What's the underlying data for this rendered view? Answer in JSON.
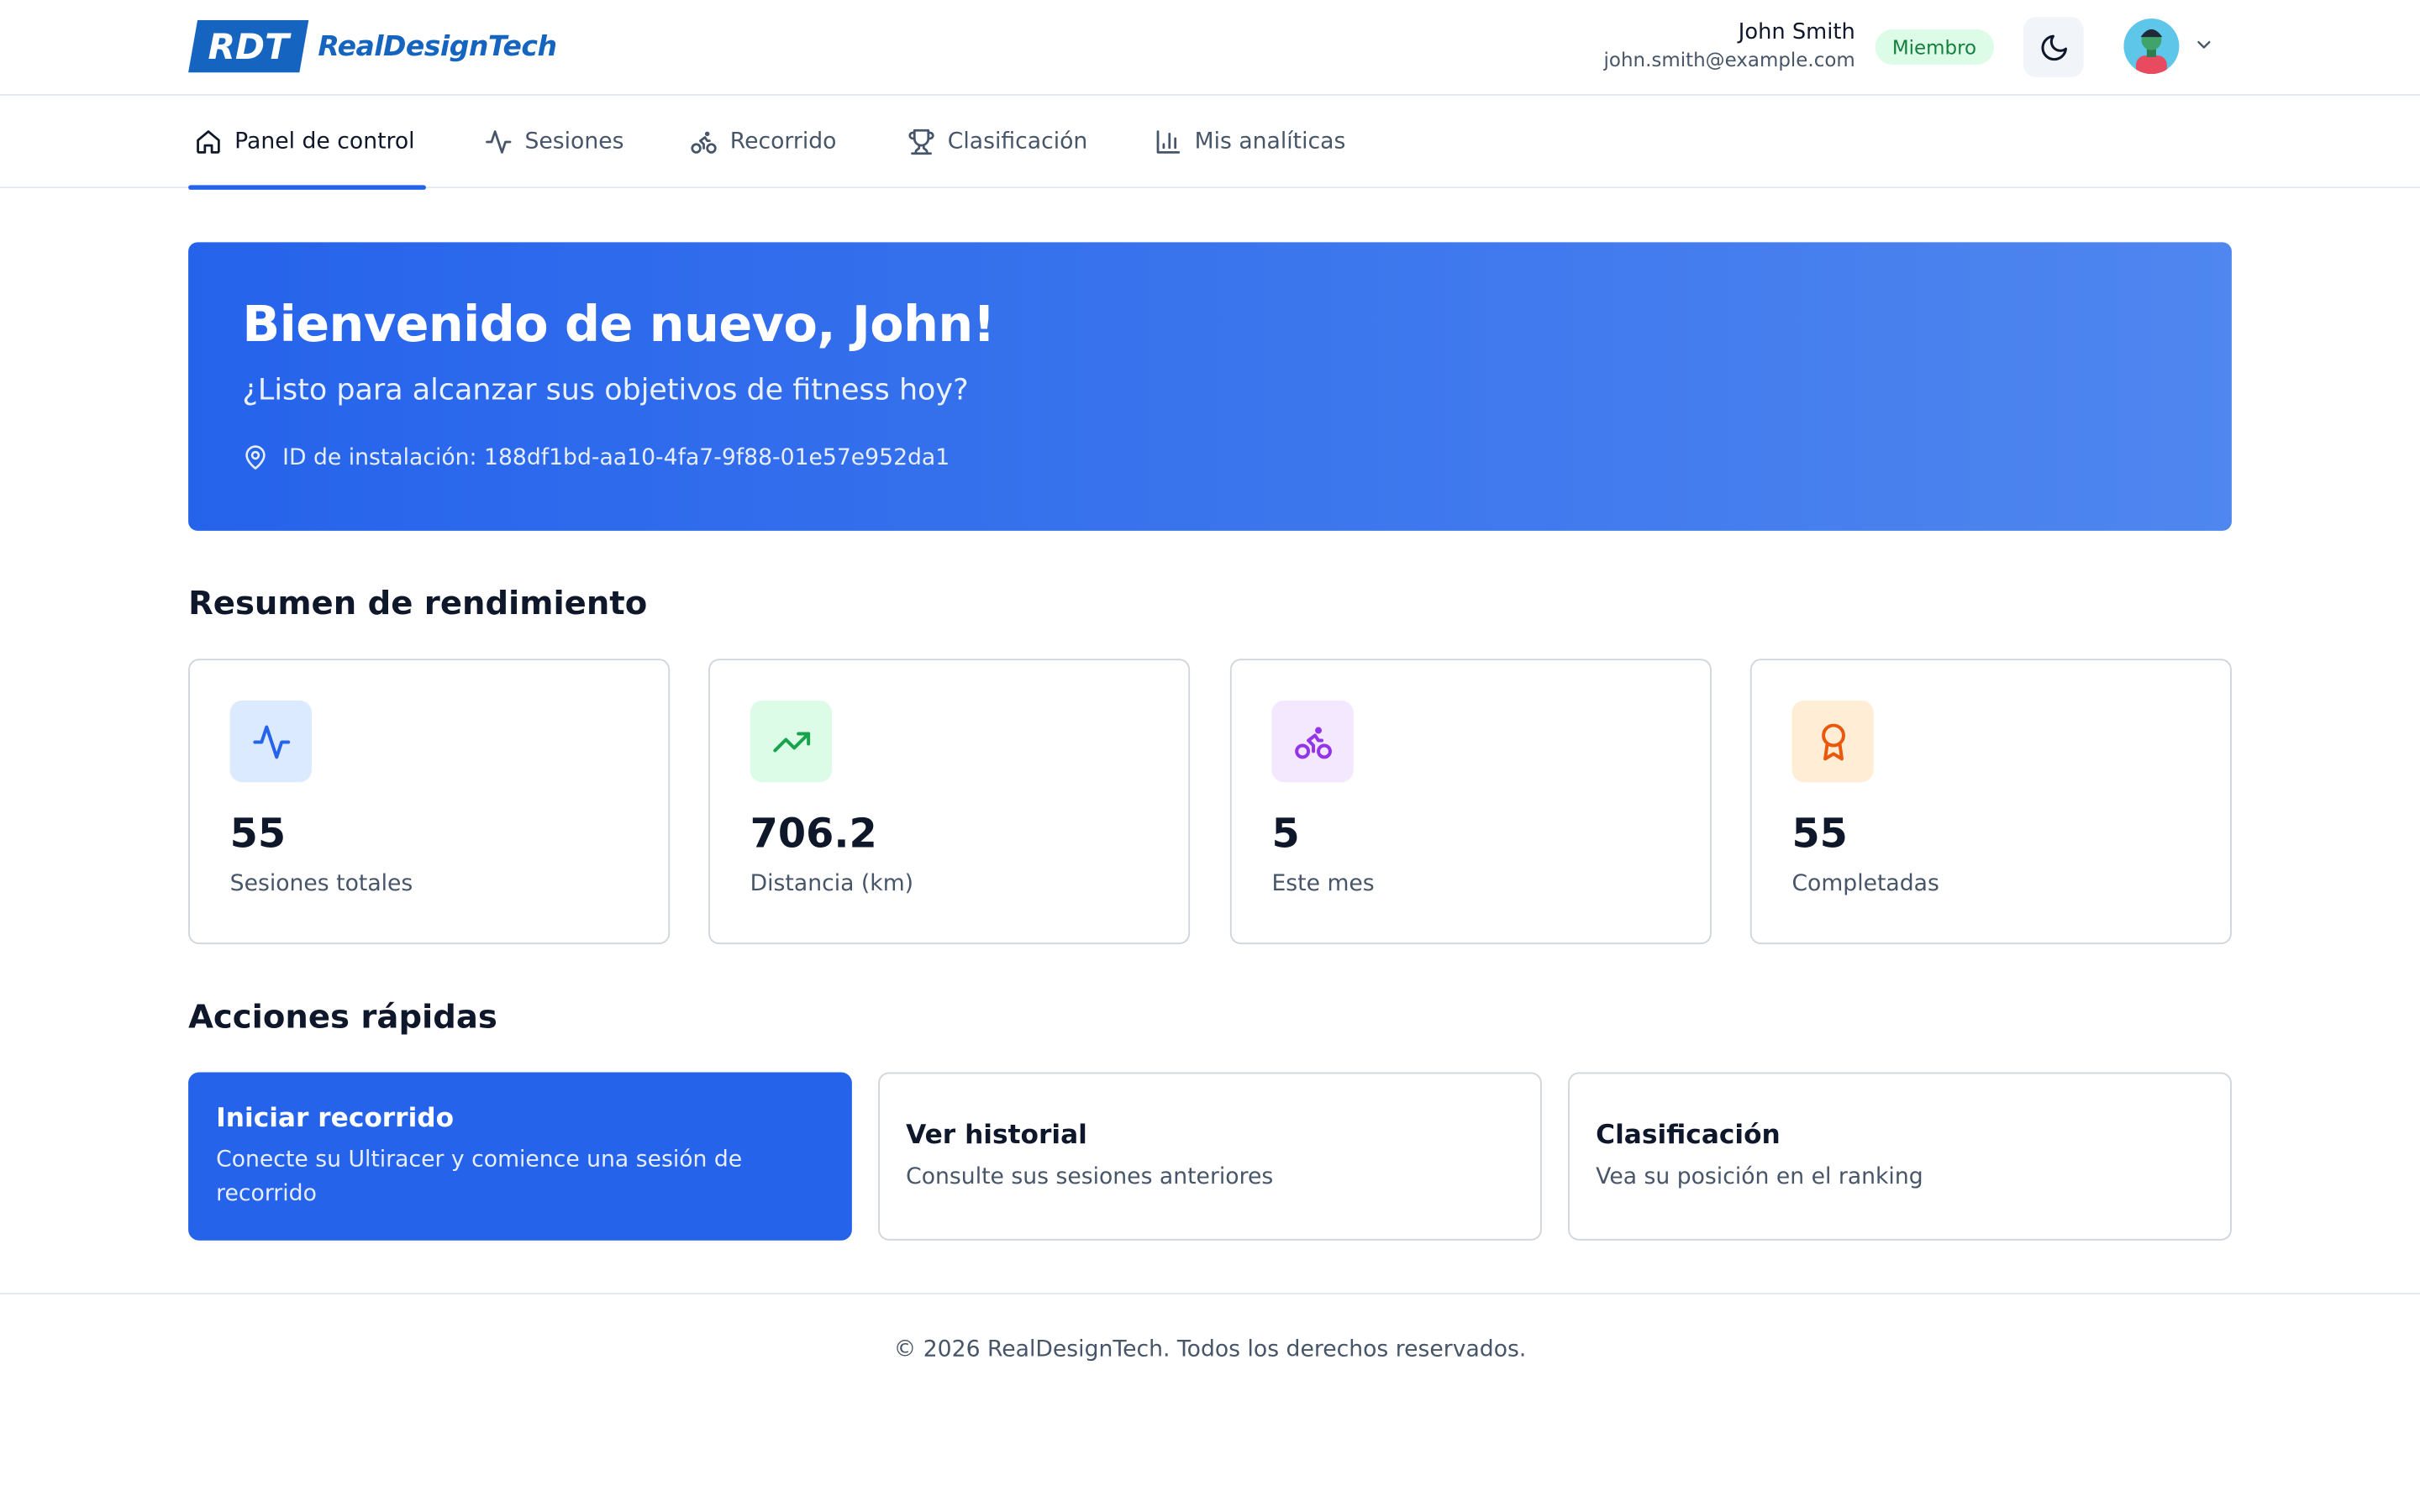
{
  "brand": {
    "mark": "RDT",
    "name": "RealDesignTech",
    "color": "#1565c0"
  },
  "user": {
    "name": "John Smith",
    "email": "john.smith@example.com",
    "role_badge": "Miembro"
  },
  "header_icons": {
    "theme": "moon-icon",
    "menu": "chevron-down-icon"
  },
  "nav": {
    "items": [
      {
        "label": "Panel de control",
        "icon": "home-icon",
        "active": true
      },
      {
        "label": "Sesiones",
        "icon": "activity-icon"
      },
      {
        "label": "Recorrido",
        "icon": "bike-icon"
      },
      {
        "label": "Clasificación",
        "icon": "trophy-icon"
      },
      {
        "label": "Mis analíticas",
        "icon": "bar-chart-icon"
      }
    ]
  },
  "hero": {
    "title": "Bienvenido de nuevo, John!",
    "subtitle": "¿Listo para alcanzar sus objetivos de fitness hoy?",
    "install_id": "ID de instalación: 188df1bd-aa10-4fa7-9f88-01e57e952da1"
  },
  "performance": {
    "title": "Resumen de rendimiento",
    "stats": [
      {
        "value": "55",
        "label": "Sesiones totales",
        "icon": "activity-icon",
        "color": "#2563eb"
      },
      {
        "value": "706.2",
        "label": "Distancia (km)",
        "icon": "trending-up-icon",
        "color": "#16a34a"
      },
      {
        "value": "5",
        "label": "Este mes",
        "icon": "bike-icon",
        "color": "#9333ea"
      },
      {
        "value": "55",
        "label": "Completadas",
        "icon": "award-icon",
        "color": "#ea580c"
      }
    ]
  },
  "quick_actions": {
    "title": "Acciones rápidas",
    "items": [
      {
        "title": "Iniciar recorrido",
        "description": "Conecte su Ultiracer y comience una sesión de recorrido"
      },
      {
        "title": "Ver historial",
        "description": "Consulte sus sesiones anteriores"
      },
      {
        "title": "Clasificación",
        "description": "Vea su posición en el ranking"
      }
    ]
  },
  "footer": {
    "text": "© 2026 RealDesignTech. Todos los derechos reservados."
  }
}
